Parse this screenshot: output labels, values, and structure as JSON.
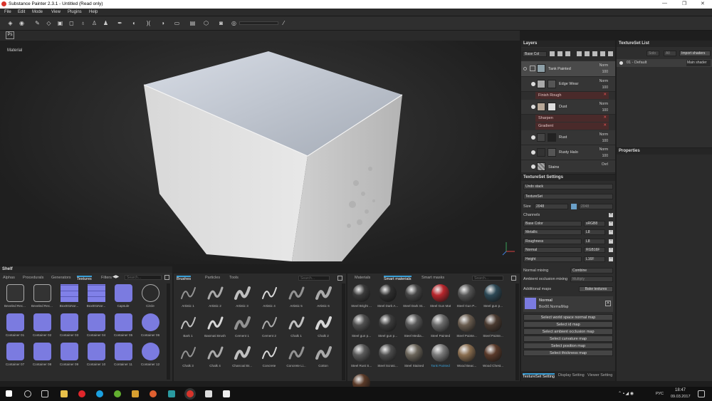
{
  "window": {
    "title": "Substance Painter 2.3.1 - Untitled (Read only)"
  },
  "menu": [
    "File",
    "Edit",
    "Mode",
    "View",
    "Plugins",
    "Help"
  ],
  "viewport": {
    "label": "Material"
  },
  "layers": {
    "title": "Layers",
    "channel": "Base Col",
    "items": [
      {
        "name": "Tank Painted",
        "blend": "Norm",
        "opacity": "100"
      },
      {
        "name": "Edge Wear",
        "blend": "Norm",
        "opacity": "100"
      },
      {
        "name": "Dust",
        "blend": "Norm",
        "opacity": "100"
      },
      {
        "name": "Rust",
        "blend": "Norm",
        "opacity": "100"
      },
      {
        "name": "Rusty Halo",
        "blend": "Norm",
        "opacity": "100"
      },
      {
        "name": "Stains",
        "blend": "Ovrl",
        "opacity": ""
      }
    ],
    "effects": [
      "Finish Rough",
      "Sharpen",
      "Gradient"
    ]
  },
  "textureset_list": {
    "title": "TextureSet List",
    "btn1": "Solo",
    "btn2": "All",
    "import_label": "Import shaders",
    "item": "01 - Default",
    "shader": "Main shader"
  },
  "properties": {
    "title": "Properties"
  },
  "tss": {
    "title": "TextureSet Settings",
    "undo": "Undo stack",
    "textureset": "TextureSet",
    "size_label": "Size",
    "size_value": "2048",
    "size_value2": "2048",
    "channels_label": "Channels",
    "channels": [
      {
        "name": "Base Color",
        "format": "sRGB8"
      },
      {
        "name": "Metallic",
        "format": "L8"
      },
      {
        "name": "Roughness",
        "format": "L8"
      },
      {
        "name": "Normal",
        "format": "RGB16F"
      },
      {
        "name": "Height",
        "format": "L16F"
      }
    ],
    "normal_mixing_label": "Normal mixing",
    "normal_mixing_value": "Combine",
    "ao_mixing_label": "Ambient occlusion mixing",
    "ao_mixing_value": "Multiply",
    "additional_maps": "Additional maps",
    "bake_btn": "Bake textures",
    "map_name": "Normal",
    "map_file": "Box00.NormalMap",
    "map_buttons": [
      "Select world space normal map",
      "Select id map",
      "Select ambient occlusion map",
      "Select curvature map",
      "Select position map",
      "Select thickness map"
    ],
    "bottom_tabs": [
      "TextureSet Setting",
      "Display Setting",
      "Viewer Setting"
    ]
  },
  "shelf": {
    "title": "Shelf",
    "tabs": [
      "Alphas",
      "Procedurals",
      "Generators",
      "Textures",
      "Filters"
    ],
    "active": "Textures",
    "search": "Search...",
    "items": [
      "Beveled Rec...",
      "Beveled Rec...",
      "Box001Nor...",
      "Box001Nor...",
      "Capsule",
      "Circle",
      "Container 01",
      "Container 02",
      "Container 03",
      "Container 04",
      "Container 05",
      "Container 06",
      "Container 07",
      "Container 08",
      "Container 09",
      "Container 10",
      "Container 11",
      "Container 12"
    ]
  },
  "brushes": {
    "tabs": [
      "Brushes",
      "Particles",
      "Tools"
    ],
    "active": "Brushes",
    "search": "Search...",
    "items": [
      "Artistic 1",
      "Artistic 2",
      "Artistic 3",
      "Artistic 4",
      "Artistic 5",
      "Artistic 6",
      "Bark 1",
      "Basmati Brush",
      "Cement 1",
      "Cement 2",
      "Chalk 1",
      "Chalk 2",
      "Chalk 3",
      "Chalk 4",
      "Charcoal Br...",
      "Concrete",
      "Concrete Li...",
      "Cotton"
    ]
  },
  "smart": {
    "tabs": [
      "Materials",
      "Smart materials",
      "Smart masks"
    ],
    "active": "Smart materials",
    "search": "Search...",
    "items": [
      "Steel Bright ...",
      "Steel Dark A...",
      "Steel Dark St...",
      "Steel Gun Mat",
      "Steel Gun P...",
      "Steel gun p...",
      "Steel gun p...",
      "Steel gun p...",
      "Steel Media...",
      "Steel Painted",
      "Steel Painte...",
      "Steel Painte...",
      "Steel Rust S...",
      "Steel Scratc...",
      "Steel Stained",
      "Tank Painted",
      "Wood Beac...",
      "Wood Chest...",
      "Wood Walnut"
    ],
    "colors": [
      "#3a3a3a",
      "#2f2f2f",
      "#444",
      "#b8262c",
      "#555",
      "#2c4855",
      "#505050",
      "#3d3d3d",
      "#585858",
      "#6b6b6b",
      "#6a5d50",
      "#4a3a30",
      "#5a5a5a",
      "#4e4e4e",
      "#6b655a",
      "#7a7a7a",
      "#8a6e50",
      "#5a3a2a",
      "#5a3a28"
    ]
  },
  "taskbar": {
    "lang": "РУС",
    "time": "18:47",
    "date": "09.03.2017"
  }
}
